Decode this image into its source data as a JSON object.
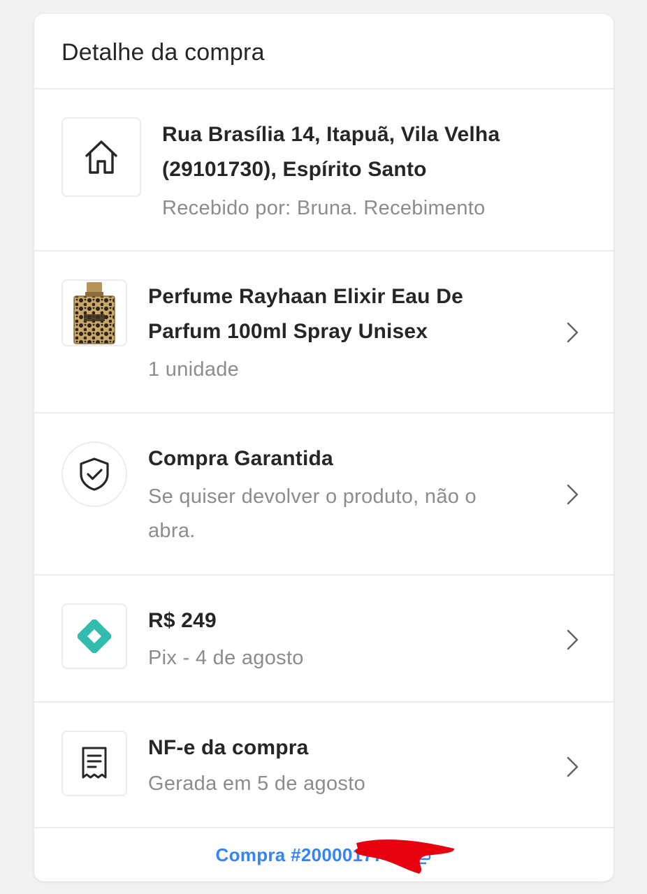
{
  "header": {
    "title": "Detalhe da compra"
  },
  "address": {
    "icon": "home-icon",
    "line1": "Rua Brasília 14, Itapuã, Vila Velha",
    "line2": "(29101730), Espírito Santo",
    "received": "Recebido por: Bruna. Recebimento"
  },
  "product": {
    "icon": "perfume-image",
    "title_line1": "Perfume Rayhaan Elixir Eau De",
    "title_line2": "Parfum 100ml Spray Unisex",
    "quantity": "1 unidade"
  },
  "guarantee": {
    "icon": "shield-check-icon",
    "title": "Compra Garantida",
    "desc_line1": "Se quiser devolver o produto, não o",
    "desc_line2": "abra."
  },
  "payment": {
    "icon": "pix-icon",
    "amount": "R$ 249",
    "method": "Pix - 4 de agosto",
    "accent": "#32bcad"
  },
  "invoice": {
    "icon": "receipt-icon",
    "title": "NF-e da compra",
    "generated": "Gerada em 5 de agosto"
  },
  "footer": {
    "order_label": "Compra #2000017747",
    "copy_icon": "copy-icon",
    "link_color": "#3483fa"
  },
  "redaction_color": "#e8000f"
}
